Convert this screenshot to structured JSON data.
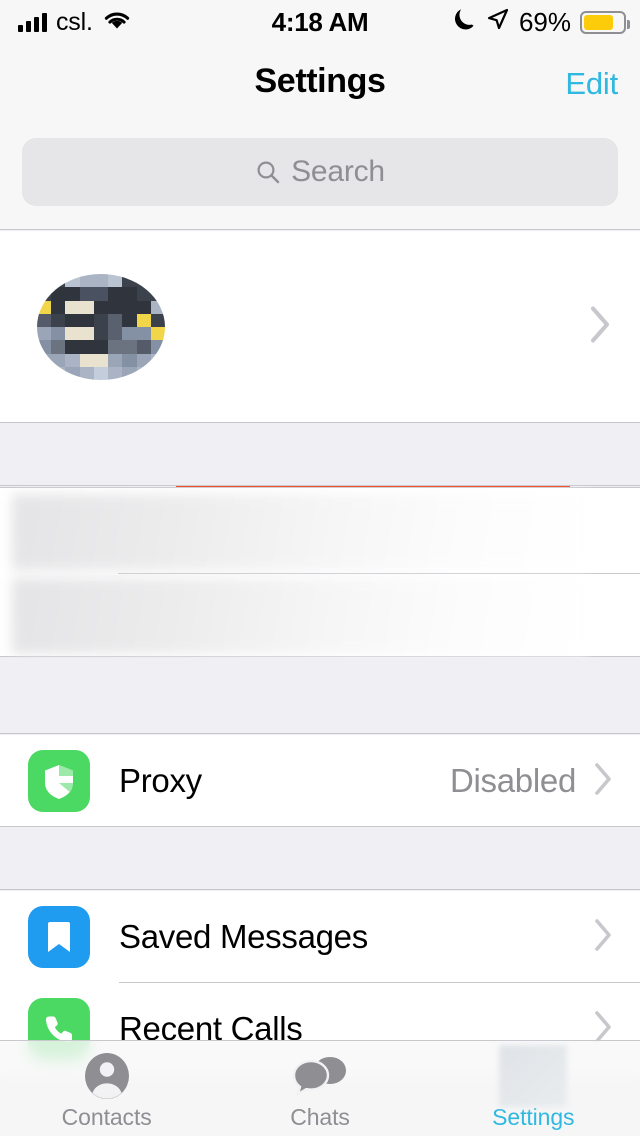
{
  "status_bar": {
    "carrier": "csl.",
    "time": "4:18 AM",
    "battery_percent": "69%",
    "signal_icon": "signal-bars-icon",
    "wifi_icon": "wifi-icon",
    "dnd_icon": "moon-icon",
    "location_icon": "location-arrow-icon",
    "battery_icon": "battery-icon",
    "battery_fill_color": "#fccc0a",
    "battery_level": 69
  },
  "header": {
    "title": "Settings",
    "edit_label": "Edit",
    "accent_color": "#2fb9e0"
  },
  "search": {
    "placeholder": "Search",
    "icon": "search-icon"
  },
  "profile": {
    "avatar_alt": "profile-avatar-censored",
    "name_censored": true,
    "details_censored": true,
    "highlight_color": "#f73f11",
    "chevron": "chevron-right-icon"
  },
  "blurred_section": {
    "rows_censored": 2
  },
  "rows": [
    {
      "label": "Proxy",
      "value": "Disabled",
      "icon": "shield-icon",
      "icon_color": "#4bd963",
      "chevron": "chevron-right-icon"
    },
    {
      "label": "Saved Messages",
      "value": "",
      "icon": "bookmark-icon",
      "icon_color": "#1f9cf0",
      "chevron": "chevron-right-icon"
    },
    {
      "label": "Recent Calls",
      "value": "",
      "icon": "phone-icon",
      "icon_color": "#4bd963",
      "chevron": "chevron-right-icon"
    }
  ],
  "tab_bar": {
    "tabs": [
      {
        "label": "Contacts",
        "icon": "person-circle-icon",
        "active": false
      },
      {
        "label": "Chats",
        "icon": "chat-bubbles-icon",
        "active": false
      },
      {
        "label": "Settings",
        "icon": "gear-icon-censored",
        "active": true
      }
    ],
    "active_color": "#2fb9e0",
    "inactive_color": "#8e8e93"
  }
}
